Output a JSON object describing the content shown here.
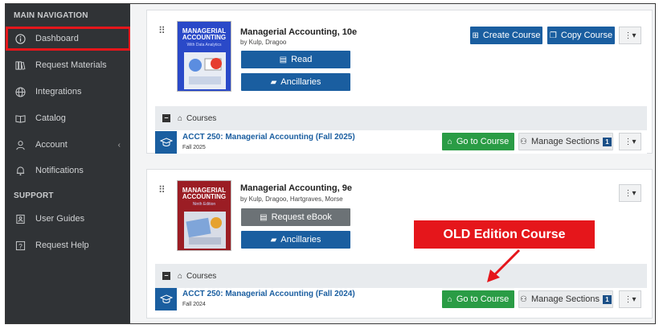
{
  "sidebar": {
    "main_header": "MAIN NAVIGATION",
    "support_header": "SUPPORT",
    "items": [
      {
        "label": "Dashboard",
        "icon": "info-circle-icon"
      },
      {
        "label": "Request Materials",
        "icon": "books-icon"
      },
      {
        "label": "Integrations",
        "icon": "globe-icon"
      },
      {
        "label": "Catalog",
        "icon": "open-book-icon"
      },
      {
        "label": "Account",
        "icon": "user-icon"
      },
      {
        "label": "Notifications",
        "icon": "bell-icon"
      }
    ],
    "support_items": [
      {
        "label": "User Guides",
        "icon": "user-guide-icon"
      },
      {
        "label": "Request Help",
        "icon": "help-icon"
      }
    ],
    "account_caret": "‹"
  },
  "books": [
    {
      "title": "Managerial Accounting, 10e",
      "authors": "by Kulp, Dragoo",
      "cover_title": "MANAGERIAL ACCOUNTING",
      "cover_sub": "With Data Analytics",
      "cover_color": "#2a49c8",
      "primary_label": "Read",
      "ancillaries_label": "Ancillaries",
      "create_label": "Create Course",
      "copy_label": "Copy Course",
      "courses_label": "Courses",
      "course": {
        "name": "ACCT 250: Managerial Accounting (Fall 2025)",
        "term": "Fall 2025",
        "go_label": "Go to Course",
        "manage_label": "Manage Sections",
        "sections_count": "1"
      }
    },
    {
      "title": "Managerial Accounting, 9e",
      "authors": "by Kulp, Dragoo, Hartgraves, Morse",
      "cover_title": "MANAGERIAL ACCOUNTING",
      "cover_sub": "Ninth Edition",
      "cover_color": "#9b1d24",
      "primary_label": "Request eBook",
      "ancillaries_label": "Ancillaries",
      "courses_label": "Courses",
      "course": {
        "name": "ACCT 250: Managerial Accounting (Fall 2024)",
        "term": "Fall 2024",
        "go_label": "Go to Course",
        "manage_label": "Manage Sections",
        "sections_count": "1"
      }
    }
  ],
  "callout": "OLD Edition Course",
  "kebab": "⋮▾",
  "drag_handle": "⠿",
  "colors": {
    "primary": "#1a5ea0",
    "success": "#2a9c45",
    "highlight": "#e5161b",
    "sidebar": "#303336"
  }
}
